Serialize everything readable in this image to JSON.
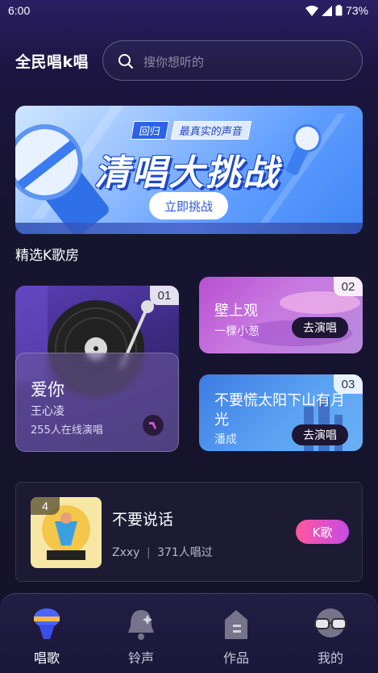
{
  "status_bar": {
    "time": "6:00",
    "battery": "73%"
  },
  "header": {
    "title": "全民唱k唱",
    "search_placeholder": "搜你想听的"
  },
  "banner": {
    "tag_1": "回归",
    "tag_2": "最真实的声音",
    "headline": "清唱大挑战",
    "cta": "立即挑战"
  },
  "section": {
    "title": "精选K歌房"
  },
  "rooms": [
    {
      "rank": "01",
      "song": "爱你",
      "artist": "王心凌",
      "online": "255人在线演唱"
    },
    {
      "rank": "02",
      "song": "壁上观",
      "artist": "一棵小葱",
      "action": "去演唱"
    },
    {
      "rank": "03",
      "song": "不要慌太阳下山有月光",
      "artist": "潘成",
      "action": "去演唱"
    }
  ],
  "song_row": {
    "rank": "4",
    "title": "不要说话",
    "artist": "Zxxy",
    "count": "371人唱过",
    "button": "K歌"
  },
  "nav": [
    {
      "label": "唱歌",
      "icon": "mic-icon",
      "active": true
    },
    {
      "label": "铃声",
      "icon": "bell-icon",
      "active": false
    },
    {
      "label": "作品",
      "icon": "works-icon",
      "active": false
    },
    {
      "label": "我的",
      "icon": "glasses-icon",
      "active": false
    }
  ],
  "colors": {
    "accent_pink": "#ff58a0",
    "accent_purple": "#c64ae3",
    "banner_blue": "#3f86f5"
  }
}
